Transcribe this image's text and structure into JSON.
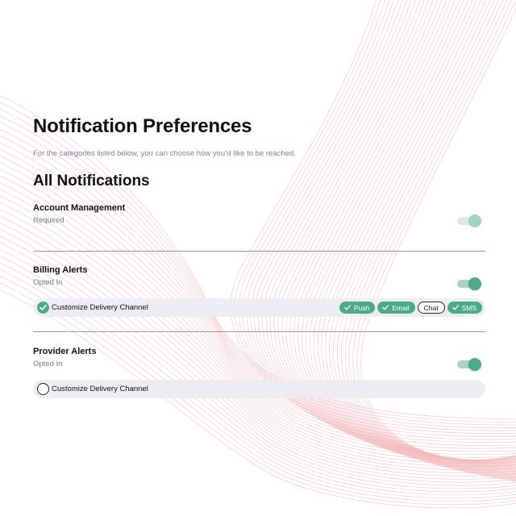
{
  "page": {
    "title": "Notification Preferences",
    "subtitle": "For the categories listed below, you can choose how you’d like to be reached.",
    "section_title": "All Notifications"
  },
  "categories": [
    {
      "name": "Account Management",
      "status": "Required",
      "toggle_on": true,
      "toggle_disabled": true
    },
    {
      "name": "Billing Alerts",
      "status": "Opted In",
      "toggle_on": true,
      "toggle_disabled": false,
      "customize": {
        "label": "Customize Delivery Channel",
        "checked": true,
        "channels": [
          {
            "label": "Push",
            "selected": true,
            "icon": "check-icon"
          },
          {
            "label": "Email",
            "selected": true,
            "icon": "check-icon"
          },
          {
            "label": "Chat",
            "selected": false
          },
          {
            "label": "SMS",
            "selected": true,
            "icon": "check-icon"
          }
        ]
      }
    },
    {
      "name": "Provider Alerts",
      "status": "Opted In",
      "toggle_on": true,
      "toggle_disabled": false,
      "customize": {
        "label": "Customize Delivery Channel",
        "checked": false
      }
    }
  ],
  "colors": {
    "accent": "#4caa8b",
    "accent_track": "#a9d3c7",
    "muted_text": "#7c8594",
    "background_lines": "#f2b8ba"
  }
}
